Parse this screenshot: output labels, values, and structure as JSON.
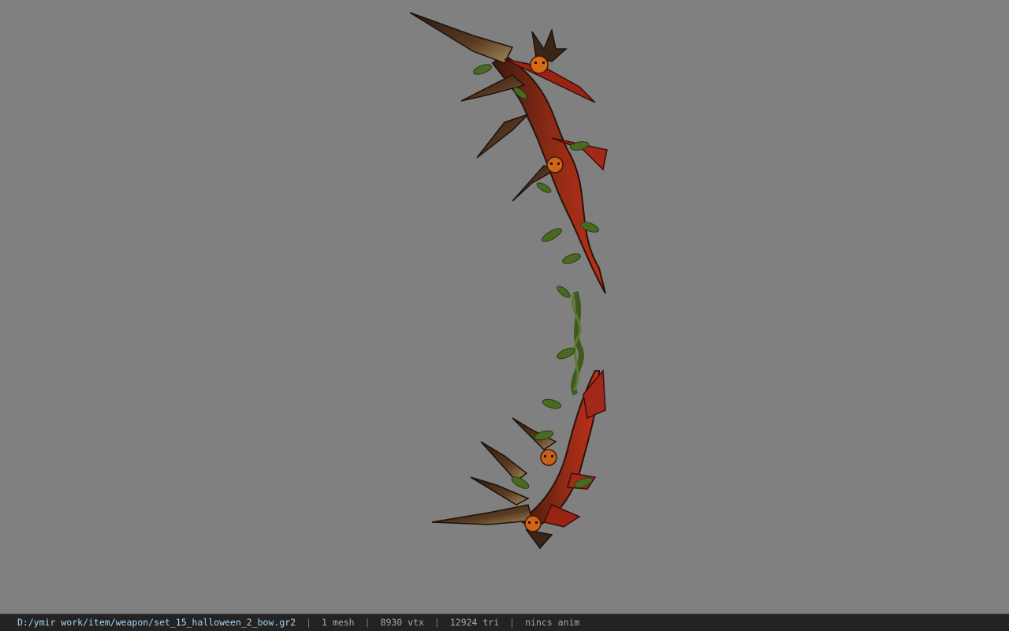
{
  "viewer": {
    "background_color": "#808080",
    "model_subject": "halloween-bow-model"
  },
  "statusbar": {
    "path": "D:/ymir work/item/weapon/set_15_halloween_2_bow.gr2",
    "separator": "|",
    "mesh": "1 mesh",
    "vtx": "8930 vtx",
    "tri": "12924 tri",
    "anim": "nincs anim"
  }
}
